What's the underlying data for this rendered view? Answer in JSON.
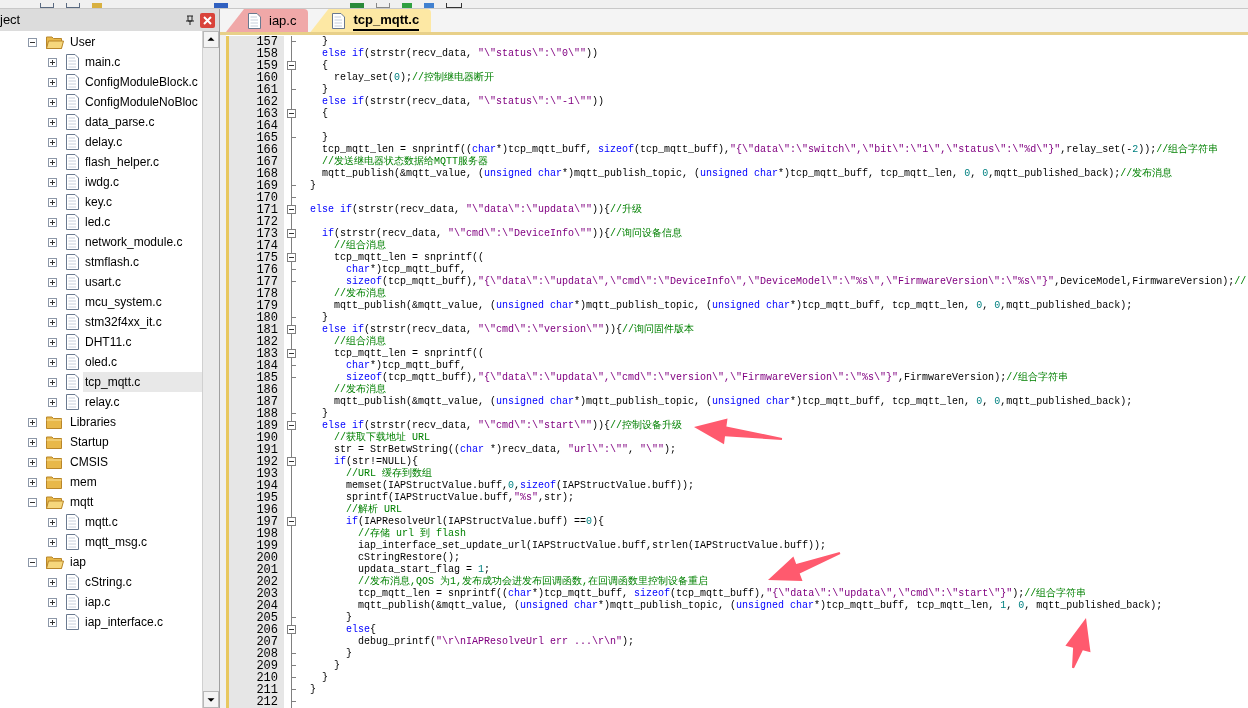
{
  "project_panel": {
    "title": "ject",
    "tree": [
      {
        "kind": "folder",
        "label": "User",
        "expanded": true,
        "selected": false,
        "children": [
          {
            "kind": "file",
            "label": "main.c",
            "expanded": false,
            "selected": false
          },
          {
            "kind": "file",
            "label": "ConfigModuleBlock.c",
            "expanded": false,
            "selected": false
          },
          {
            "kind": "file",
            "label": "ConfigModuleNoBloc",
            "expanded": false,
            "selected": false
          },
          {
            "kind": "file",
            "label": "data_parse.c",
            "expanded": false,
            "selected": false
          },
          {
            "kind": "file",
            "label": "delay.c",
            "expanded": false,
            "selected": false
          },
          {
            "kind": "file",
            "label": "flash_helper.c",
            "expanded": false,
            "selected": false
          },
          {
            "kind": "file",
            "label": "iwdg.c",
            "expanded": false,
            "selected": false
          },
          {
            "kind": "file",
            "label": "key.c",
            "expanded": false,
            "selected": false
          },
          {
            "kind": "file",
            "label": "led.c",
            "expanded": false,
            "selected": false
          },
          {
            "kind": "file",
            "label": "network_module.c",
            "expanded": false,
            "selected": false
          },
          {
            "kind": "file",
            "label": "stmflash.c",
            "expanded": false,
            "selected": false
          },
          {
            "kind": "file",
            "label": "usart.c",
            "expanded": false,
            "selected": false
          },
          {
            "kind": "file",
            "label": "mcu_system.c",
            "expanded": false,
            "selected": false
          },
          {
            "kind": "file",
            "label": "stm32f4xx_it.c",
            "expanded": false,
            "selected": false
          },
          {
            "kind": "file",
            "label": "DHT11.c",
            "expanded": false,
            "selected": false
          },
          {
            "kind": "file",
            "label": "oled.c",
            "expanded": false,
            "selected": false
          },
          {
            "kind": "file",
            "label": "tcp_mqtt.c",
            "expanded": false,
            "selected": true
          },
          {
            "kind": "file",
            "label": "relay.c",
            "expanded": false,
            "selected": false
          }
        ]
      },
      {
        "kind": "folder",
        "label": "Libraries",
        "expanded": false,
        "selected": false
      },
      {
        "kind": "folder",
        "label": "Startup",
        "expanded": false,
        "selected": false
      },
      {
        "kind": "folder",
        "label": "CMSIS",
        "expanded": false,
        "selected": false
      },
      {
        "kind": "folder",
        "label": "mem",
        "expanded": false,
        "selected": false
      },
      {
        "kind": "folder",
        "label": "mqtt",
        "expanded": true,
        "selected": false,
        "children": [
          {
            "kind": "file",
            "label": "mqtt.c",
            "expanded": false,
            "selected": false
          },
          {
            "kind": "file",
            "label": "mqtt_msg.c",
            "expanded": false,
            "selected": false
          }
        ]
      },
      {
        "kind": "folder",
        "label": "iap",
        "expanded": true,
        "selected": false,
        "children": [
          {
            "kind": "file",
            "label": "cString.c",
            "expanded": false,
            "selected": false
          },
          {
            "kind": "file",
            "label": "iap.c",
            "expanded": false,
            "selected": false
          },
          {
            "kind": "file",
            "label": "iap_interface.c",
            "expanded": false,
            "selected": false
          }
        ]
      }
    ]
  },
  "editor": {
    "tabs": [
      {
        "label": "iap.c",
        "selected": false
      },
      {
        "label": "tcp_mqtt.c",
        "selected": true
      }
    ],
    "lines": [
      {
        "number": "157",
        "kind": "closer",
        "tokens": [
          {
            "kind": "plain",
            "text": "  }"
          }
        ]
      },
      {
        "number": "158",
        "kind": "body",
        "tokens": [
          {
            "kind": "keyword",
            "text": "  else if"
          },
          {
            "kind": "plain",
            "text": "(strstr(recv_data, "
          },
          {
            "kind": "string",
            "text": "\"\\\"status\\\":\\\"0\\\"\""
          },
          {
            "kind": "plain",
            "text": "))"
          }
        ]
      },
      {
        "number": "159",
        "kind": "opener",
        "tokens": [
          {
            "kind": "plain",
            "text": "  {"
          }
        ]
      },
      {
        "number": "160",
        "kind": "body",
        "tokens": [
          {
            "kind": "plain",
            "text": "    relay_set("
          },
          {
            "kind": "number",
            "text": "0"
          },
          {
            "kind": "plain",
            "text": ");"
          },
          {
            "kind": "comment",
            "text": "//控制继电器断开"
          }
        ]
      },
      {
        "number": "161",
        "kind": "closer",
        "tokens": [
          {
            "kind": "plain",
            "text": "  }"
          }
        ]
      },
      {
        "number": "162",
        "kind": "body",
        "tokens": [
          {
            "kind": "keyword",
            "text": "  else if"
          },
          {
            "kind": "plain",
            "text": "(strstr(recv_data, "
          },
          {
            "kind": "string",
            "text": "\"\\\"status\\\":\\\"-1\\\"\""
          },
          {
            "kind": "plain",
            "text": "))"
          }
        ]
      },
      {
        "number": "163",
        "kind": "opener",
        "tokens": [
          {
            "kind": "plain",
            "text": "  {"
          }
        ]
      },
      {
        "number": "164",
        "kind": "body"
      },
      {
        "number": "165",
        "kind": "closer",
        "tokens": [
          {
            "kind": "plain",
            "text": "  }"
          }
        ]
      },
      {
        "number": "166",
        "kind": "body",
        "tokens": [
          {
            "kind": "plain",
            "text": "  tcp_mqtt_len = snprintf(("
          },
          {
            "kind": "keyword",
            "text": "char"
          },
          {
            "kind": "plain",
            "text": "*)tcp_mqtt_buff, "
          },
          {
            "kind": "keyword",
            "text": "sizeof"
          },
          {
            "kind": "plain",
            "text": "(tcp_mqtt_buff),"
          },
          {
            "kind": "string",
            "text": "\"{\\\"data\\\":\\\"switch\\\",\\\"bit\\\":\\\"1\\\",\\\"status\\\":\\\"%d\\\"}\""
          },
          {
            "kind": "plain",
            "text": ",relay_set(-"
          },
          {
            "kind": "number",
            "text": "2"
          },
          {
            "kind": "plain",
            "text": "));"
          },
          {
            "kind": "comment",
            "text": "//组合字符串"
          }
        ]
      },
      {
        "number": "167",
        "kind": "body",
        "tokens": [
          {
            "kind": "comment",
            "text": "  //发送继电器状态数据给MQTT服务器"
          }
        ]
      },
      {
        "number": "168",
        "kind": "body",
        "tokens": [
          {
            "kind": "plain",
            "text": "  mqtt_publish(&mqtt_value, ("
          },
          {
            "kind": "keyword",
            "text": "unsigned char"
          },
          {
            "kind": "plain",
            "text": "*)mqtt_publish_topic, ("
          },
          {
            "kind": "keyword",
            "text": "unsigned char"
          },
          {
            "kind": "plain",
            "text": "*)tcp_mqtt_buff, tcp_mqtt_len, "
          },
          {
            "kind": "number",
            "text": "0"
          },
          {
            "kind": "plain",
            "text": ", "
          },
          {
            "kind": "number",
            "text": "0"
          },
          {
            "kind": "plain",
            "text": ",mqtt_published_back);"
          },
          {
            "kind": "comment",
            "text": "//发布消息"
          }
        ]
      },
      {
        "number": "169",
        "kind": "closer",
        "tokens": [
          {
            "kind": "plain",
            "text": "}"
          }
        ]
      },
      {
        "number": "170",
        "kind": "closer"
      },
      {
        "number": "171",
        "kind": "opener",
        "tokens": [
          {
            "kind": "keyword",
            "text": "else if"
          },
          {
            "kind": "plain",
            "text": "(strstr(recv_data, "
          },
          {
            "kind": "string",
            "text": "\"\\\"data\\\":\\\"updata\\\"\""
          },
          {
            "kind": "plain",
            "text": ")){"
          },
          {
            "kind": "comment",
            "text": "//升级"
          }
        ]
      },
      {
        "number": "172",
        "kind": "body"
      },
      {
        "number": "173",
        "kind": "opener",
        "tokens": [
          {
            "kind": "keyword",
            "text": "  if"
          },
          {
            "kind": "plain",
            "text": "(strstr(recv_data, "
          },
          {
            "kind": "string",
            "text": "\"\\\"cmd\\\":\\\"DeviceInfo\\\"\""
          },
          {
            "kind": "plain",
            "text": ")){"
          },
          {
            "kind": "comment",
            "text": "//询问设备信息"
          }
        ]
      },
      {
        "number": "174",
        "kind": "body",
        "tokens": [
          {
            "kind": "comment",
            "text": "    //组合消息"
          }
        ]
      },
      {
        "number": "175",
        "kind": "opener",
        "tokens": [
          {
            "kind": "plain",
            "text": "    tcp_mqtt_len = snprintf(("
          }
        ]
      },
      {
        "number": "176",
        "kind": "closer",
        "tokens": [
          {
            "kind": "keyword",
            "text": "      char"
          },
          {
            "kind": "plain",
            "text": "*)tcp_mqtt_buff,"
          }
        ]
      },
      {
        "number": "177",
        "kind": "closer",
        "tokens": [
          {
            "kind": "keyword",
            "text": "      sizeof"
          },
          {
            "kind": "plain",
            "text": "(tcp_mqtt_buff),"
          },
          {
            "kind": "string",
            "text": "\"{\\\"data\\\":\\\"updata\\\",\\\"cmd\\\":\\\"DeviceInfo\\\",\\\"DeviceModel\\\":\\\"%s\\\",\\\"FirmwareVersion\\\":\\\"%s\\\"}\""
          },
          {
            "kind": "plain",
            "text": ",DeviceModel,FirmwareVersion);"
          },
          {
            "kind": "comment",
            "text": "//"
          }
        ]
      },
      {
        "number": "178",
        "kind": "body",
        "tokens": [
          {
            "kind": "comment",
            "text": "    //发布消息"
          }
        ]
      },
      {
        "number": "179",
        "kind": "body",
        "tokens": [
          {
            "kind": "plain",
            "text": "    mqtt_publish(&mqtt_value, ("
          },
          {
            "kind": "keyword",
            "text": "unsigned char"
          },
          {
            "kind": "plain",
            "text": "*)mqtt_publish_topic, ("
          },
          {
            "kind": "keyword",
            "text": "unsigned char"
          },
          {
            "kind": "plain",
            "text": "*)tcp_mqtt_buff, tcp_mqtt_len, "
          },
          {
            "kind": "number",
            "text": "0"
          },
          {
            "kind": "plain",
            "text": ", "
          },
          {
            "kind": "number",
            "text": "0"
          },
          {
            "kind": "plain",
            "text": ",mqtt_published_back);"
          }
        ]
      },
      {
        "number": "180",
        "kind": "closer",
        "tokens": [
          {
            "kind": "plain",
            "text": "  }"
          }
        ]
      },
      {
        "number": "181",
        "kind": "opener",
        "tokens": [
          {
            "kind": "keyword",
            "text": "  else if"
          },
          {
            "kind": "plain",
            "text": "(strstr(recv_data, "
          },
          {
            "kind": "string",
            "text": "\"\\\"cmd\\\":\\\"version\\\"\""
          },
          {
            "kind": "plain",
            "text": ")){"
          },
          {
            "kind": "comment",
            "text": "//询问固件版本"
          }
        ]
      },
      {
        "number": "182",
        "kind": "body",
        "tokens": [
          {
            "kind": "comment",
            "text": "    //组合消息"
          }
        ]
      },
      {
        "number": "183",
        "kind": "opener",
        "tokens": [
          {
            "kind": "plain",
            "text": "    tcp_mqtt_len = snprintf(("
          }
        ]
      },
      {
        "number": "184",
        "kind": "closer",
        "tokens": [
          {
            "kind": "keyword",
            "text": "      char"
          },
          {
            "kind": "plain",
            "text": "*)tcp_mqtt_buff,"
          }
        ]
      },
      {
        "number": "185",
        "kind": "closer",
        "tokens": [
          {
            "kind": "keyword",
            "text": "      sizeof"
          },
          {
            "kind": "plain",
            "text": "(tcp_mqtt_buff),"
          },
          {
            "kind": "string",
            "text": "\"{\\\"data\\\":\\\"updata\\\",\\\"cmd\\\":\\\"version\\\",\\\"FirmwareVersion\\\":\\\"%s\\\"}\""
          },
          {
            "kind": "plain",
            "text": ",FirmwareVersion);"
          },
          {
            "kind": "comment",
            "text": "//组合字符串"
          }
        ]
      },
      {
        "number": "186",
        "kind": "body",
        "tokens": [
          {
            "kind": "comment",
            "text": "    //发布消息"
          }
        ]
      },
      {
        "number": "187",
        "kind": "body",
        "tokens": [
          {
            "kind": "plain",
            "text": "    mqtt_publish(&mqtt_value, ("
          },
          {
            "kind": "keyword",
            "text": "unsigned char"
          },
          {
            "kind": "plain",
            "text": "*)mqtt_publish_topic, ("
          },
          {
            "kind": "keyword",
            "text": "unsigned char"
          },
          {
            "kind": "plain",
            "text": "*)tcp_mqtt_buff, tcp_mqtt_len, "
          },
          {
            "kind": "number",
            "text": "0"
          },
          {
            "kind": "plain",
            "text": ", "
          },
          {
            "kind": "number",
            "text": "0"
          },
          {
            "kind": "plain",
            "text": ",mqtt_published_back);"
          }
        ]
      },
      {
        "number": "188",
        "kind": "closer",
        "tokens": [
          {
            "kind": "plain",
            "text": "  }"
          }
        ]
      },
      {
        "number": "189",
        "kind": "opener",
        "tokens": [
          {
            "kind": "keyword",
            "text": "  else if"
          },
          {
            "kind": "plain",
            "text": "(strstr(recv_data, "
          },
          {
            "kind": "string",
            "text": "\"\\\"cmd\\\":\\\"start\\\"\""
          },
          {
            "kind": "plain",
            "text": ")){"
          },
          {
            "kind": "comment",
            "text": "//控制设备升级"
          }
        ]
      },
      {
        "number": "190",
        "kind": "body",
        "tokens": [
          {
            "kind": "comment",
            "text": "    //获取下载地址 URL"
          }
        ]
      },
      {
        "number": "191",
        "kind": "body",
        "tokens": [
          {
            "kind": "plain",
            "text": "    str = StrBetwString(("
          },
          {
            "kind": "keyword",
            "text": "char"
          },
          {
            "kind": "plain",
            "text": " *)recv_data, "
          },
          {
            "kind": "string",
            "text": "\"url\\\":\\\"\""
          },
          {
            "kind": "plain",
            "text": ", "
          },
          {
            "kind": "string",
            "text": "\"\\\"\""
          },
          {
            "kind": "plain",
            "text": ");"
          }
        ]
      },
      {
        "number": "192",
        "kind": "opener",
        "tokens": [
          {
            "kind": "keyword",
            "text": "    if"
          },
          {
            "kind": "plain",
            "text": "(str!=NULL){"
          }
        ]
      },
      {
        "number": "193",
        "kind": "body",
        "tokens": [
          {
            "kind": "comment",
            "text": "      //URL 缓存到数组"
          }
        ]
      },
      {
        "number": "194",
        "kind": "body",
        "tokens": [
          {
            "kind": "plain",
            "text": "      memset(IAPStructValue.buff,"
          },
          {
            "kind": "number",
            "text": "0"
          },
          {
            "kind": "plain",
            "text": ","
          },
          {
            "kind": "keyword",
            "text": "sizeof"
          },
          {
            "kind": "plain",
            "text": "(IAPStructValue.buff));"
          }
        ]
      },
      {
        "number": "195",
        "kind": "body",
        "tokens": [
          {
            "kind": "plain",
            "text": "      sprintf(IAPStructValue.buff,"
          },
          {
            "kind": "string",
            "text": "\"%s\""
          },
          {
            "kind": "plain",
            "text": ",str);"
          }
        ]
      },
      {
        "number": "196",
        "kind": "body",
        "tokens": [
          {
            "kind": "comment",
            "text": "      //解析 URL"
          }
        ]
      },
      {
        "number": "197",
        "kind": "opener",
        "tokens": [
          {
            "kind": "keyword",
            "text": "      if"
          },
          {
            "kind": "plain",
            "text": "(IAPResolveUrl(IAPStructValue.buff) =="
          },
          {
            "kind": "number",
            "text": "0"
          },
          {
            "kind": "plain",
            "text": "){"
          }
        ]
      },
      {
        "number": "198",
        "kind": "body",
        "tokens": [
          {
            "kind": "comment",
            "text": "        //存储 url 到 flash"
          }
        ]
      },
      {
        "number": "199",
        "kind": "body",
        "tokens": [
          {
            "kind": "plain",
            "text": "        iap_interface_set_update_url(IAPStructValue.buff,strlen(IAPStructValue.buff));"
          }
        ]
      },
      {
        "number": "200",
        "kind": "body",
        "tokens": [
          {
            "kind": "plain",
            "text": "        cStringRestore();"
          }
        ]
      },
      {
        "number": "201",
        "kind": "body",
        "tokens": [
          {
            "kind": "plain",
            "text": "        updata_start_flag = "
          },
          {
            "kind": "number",
            "text": "1"
          },
          {
            "kind": "plain",
            "text": ";"
          }
        ]
      },
      {
        "number": "202",
        "kind": "body",
        "tokens": [
          {
            "kind": "comment",
            "text": "        //发布消息,QOS 为1,发布成功会进发布回调函数,在回调函数里控制设备重启"
          }
        ]
      },
      {
        "number": "203",
        "kind": "body",
        "tokens": [
          {
            "kind": "plain",
            "text": "        tcp_mqtt_len = snprintf(("
          },
          {
            "kind": "keyword",
            "text": "char"
          },
          {
            "kind": "plain",
            "text": "*)tcp_mqtt_buff, "
          },
          {
            "kind": "keyword",
            "text": "sizeof"
          },
          {
            "kind": "plain",
            "text": "(tcp_mqtt_buff),"
          },
          {
            "kind": "string",
            "text": "\"{\\\"data\\\":\\\"updata\\\",\\\"cmd\\\":\\\"start\\\"}\""
          },
          {
            "kind": "plain",
            "text": ");"
          },
          {
            "kind": "comment",
            "text": "//组合字符串"
          }
        ]
      },
      {
        "number": "204",
        "kind": "body",
        "tokens": [
          {
            "kind": "plain",
            "text": "        mqtt_publish(&mqtt_value, ("
          },
          {
            "kind": "keyword",
            "text": "unsigned char"
          },
          {
            "kind": "plain",
            "text": "*)mqtt_publish_topic, ("
          },
          {
            "kind": "keyword",
            "text": "unsigned char"
          },
          {
            "kind": "plain",
            "text": "*)tcp_mqtt_buff, tcp_mqtt_len, "
          },
          {
            "kind": "number",
            "text": "1"
          },
          {
            "kind": "plain",
            "text": ", "
          },
          {
            "kind": "number",
            "text": "0"
          },
          {
            "kind": "plain",
            "text": ", mqtt_published_back);"
          }
        ]
      },
      {
        "number": "205",
        "kind": "closer",
        "tokens": [
          {
            "kind": "plain",
            "text": "      }"
          }
        ]
      },
      {
        "number": "206",
        "kind": "opener",
        "tokens": [
          {
            "kind": "keyword",
            "text": "      else"
          },
          {
            "kind": "plain",
            "text": "{"
          }
        ]
      },
      {
        "number": "207",
        "kind": "body",
        "tokens": [
          {
            "kind": "plain",
            "text": "        debug_printf("
          },
          {
            "kind": "string",
            "text": "\"\\r\\nIAPResolveUrl err ...\\r\\n\""
          },
          {
            "kind": "plain",
            "text": ");"
          }
        ]
      },
      {
        "number": "208",
        "kind": "closer",
        "tokens": [
          {
            "kind": "plain",
            "text": "      }"
          }
        ]
      },
      {
        "number": "209",
        "kind": "closer",
        "tokens": [
          {
            "kind": "plain",
            "text": "    }"
          }
        ]
      },
      {
        "number": "210",
        "kind": "closer",
        "tokens": [
          {
            "kind": "plain",
            "text": "  }"
          }
        ]
      },
      {
        "number": "211",
        "kind": "closer",
        "tokens": [
          {
            "kind": "plain",
            "text": "}"
          }
        ]
      },
      {
        "number": "212",
        "kind": "closer"
      }
    ]
  }
}
